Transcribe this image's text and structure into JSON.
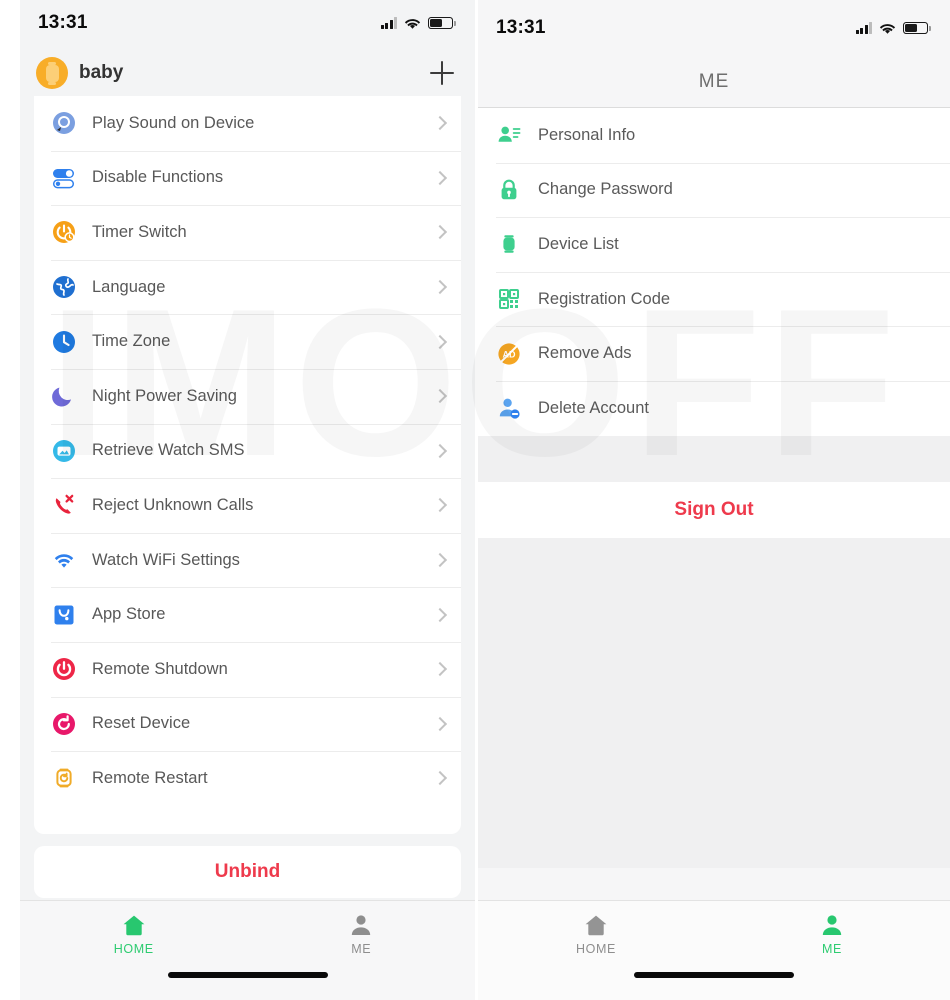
{
  "watermark": "IMOOFF",
  "colors": {
    "accent_green": "#2ecc71",
    "danger_red": "#ee3a4c",
    "icon_green": "#3ECF8E",
    "avatar_orange": "#f8ad28"
  },
  "left_phone": {
    "status_bar": {
      "time": "13:31",
      "signal_icon": "cellular-signal-icon",
      "wifi_icon": "wifi-icon",
      "battery_icon": "battery-icon"
    },
    "device_header": {
      "avatar_icon": "watch-avatar-icon",
      "device_name": "baby",
      "add_icon": "plus-icon"
    },
    "settings": [
      {
        "label": "Play Sound on Device",
        "icon": "play-sound-icon"
      },
      {
        "label": "Disable Functions",
        "icon": "toggle-switches-icon"
      },
      {
        "label": "Timer Switch",
        "icon": "timer-switch-icon"
      },
      {
        "label": "Language",
        "icon": "globe-icon"
      },
      {
        "label": "Time Zone",
        "icon": "clock-icon"
      },
      {
        "label": "Night Power Saving",
        "icon": "moon-icon"
      },
      {
        "label": "Retrieve Watch SMS",
        "icon": "sms-icon"
      },
      {
        "label": "Reject Unknown Calls",
        "icon": "reject-call-icon"
      },
      {
        "label": "Watch WiFi Settings",
        "icon": "wifi-settings-icon"
      },
      {
        "label": "App Store",
        "icon": "app-store-icon"
      },
      {
        "label": "Remote Shutdown",
        "icon": "power-icon"
      },
      {
        "label": "Reset Device",
        "icon": "reset-icon"
      },
      {
        "label": "Remote Restart",
        "icon": "restart-watch-icon"
      }
    ],
    "unbind_label": "Unbind",
    "tabs": [
      {
        "label": "HOME",
        "icon": "home-icon",
        "active": true
      },
      {
        "label": "ME",
        "icon": "person-icon",
        "active": false
      }
    ]
  },
  "right_phone": {
    "status_bar": {
      "time": "13:31",
      "signal_icon": "cellular-signal-icon",
      "wifi_icon": "wifi-icon",
      "battery_icon": "battery-icon"
    },
    "header_title": "ME",
    "menu": [
      {
        "label": "Personal Info",
        "icon": "person-card-icon"
      },
      {
        "label": "Change Password",
        "icon": "lock-icon"
      },
      {
        "label": "Device List",
        "icon": "watch-icon"
      },
      {
        "label": "Registration Code",
        "icon": "qr-code-icon"
      },
      {
        "label": "Remove Ads",
        "icon": "no-ads-icon"
      },
      {
        "label": "Delete Account",
        "icon": "delete-account-icon"
      }
    ],
    "sign_out_label": "Sign Out",
    "tabs": [
      {
        "label": "HOME",
        "icon": "home-icon",
        "active": false
      },
      {
        "label": "ME",
        "icon": "person-icon",
        "active": true
      }
    ]
  }
}
